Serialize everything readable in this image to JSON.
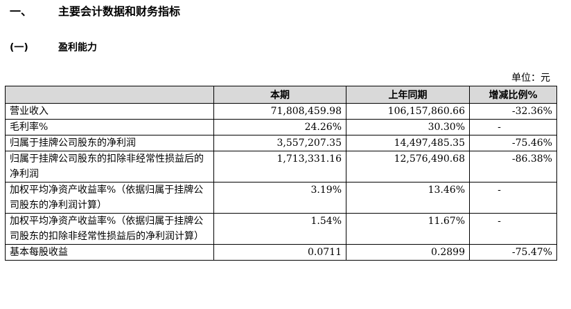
{
  "section": {
    "number": "一、",
    "title": "主要会计数据和财务指标"
  },
  "subsection": {
    "number": "(一)",
    "title": "盈利能力"
  },
  "unit": "单位：元",
  "table": {
    "headers": [
      "",
      "本期",
      "上年同期",
      "增减比例%"
    ],
    "rows": [
      {
        "label": "营业收入",
        "current": "71,808,459.98",
        "previous": "106,157,860.66",
        "change": "-32.36%"
      },
      {
        "label": "毛利率%",
        "current": "24.26%",
        "previous": "30.30%",
        "change": "-"
      },
      {
        "label": "归属于挂牌公司股东的净利润",
        "current": "3,557,207.35",
        "previous": "14,497,485.35",
        "change": "-75.46%"
      },
      {
        "label": "归属于挂牌公司股东的扣除非经常性损益后的净利润",
        "current": "1,713,331.16",
        "previous": "12,576,490.68",
        "change": "-86.38%"
      },
      {
        "label": "加权平均净资产收益率%（依据归属于挂牌公司股东的净利润计算）",
        "current": "3.19%",
        "previous": "13.46%",
        "change": "-"
      },
      {
        "label": "加权平均净资产收益率%（依据归属于挂牌公司股东的扣除非经常性损益后的净利润计算）",
        "current": "1.54%",
        "previous": "11.67%",
        "change": "-"
      },
      {
        "label": "基本每股收益",
        "current": "0.0711",
        "previous": "0.2899",
        "change": "-75.47%"
      }
    ]
  }
}
